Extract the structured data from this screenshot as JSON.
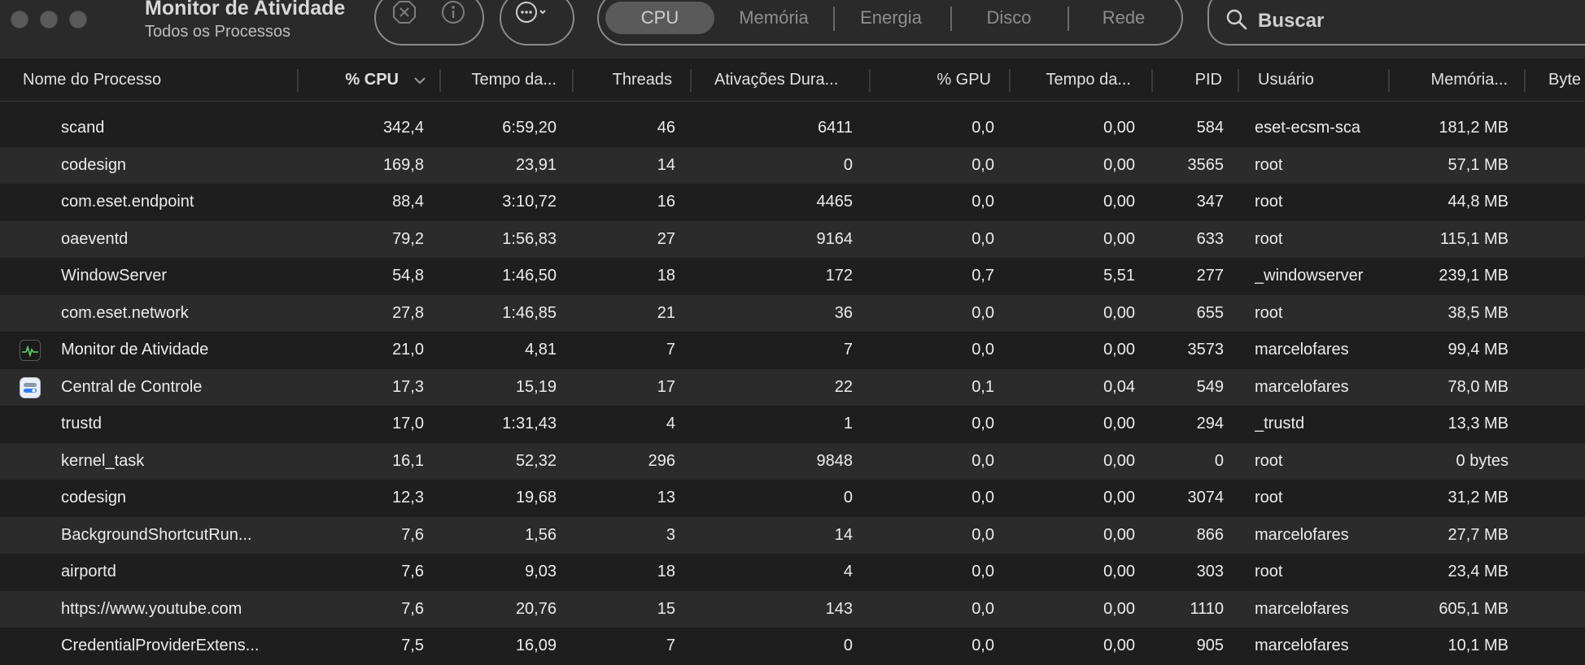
{
  "window": {
    "title": "Monitor de Atividade",
    "subtitle": "Todos os Processos"
  },
  "toolbar": {
    "stop_icon": "stop-process-icon",
    "info_icon": "info-icon",
    "more_icon": "more-options-icon",
    "tabs": [
      {
        "label": "CPU",
        "active": true
      },
      {
        "label": "Memória",
        "active": false
      },
      {
        "label": "Energia",
        "active": false
      },
      {
        "label": "Disco",
        "active": false
      },
      {
        "label": "Rede",
        "active": false
      }
    ],
    "search_label": "Buscar"
  },
  "columns": [
    "Nome do Processo",
    "% CPU",
    "Tempo da...",
    "Threads",
    "Ativações Dura...",
    "% GPU",
    "Tempo da...",
    "PID",
    "Usuário",
    "Memória...",
    "Byte"
  ],
  "sort": {
    "column": "% CPU",
    "direction": "descending"
  },
  "processes": [
    {
      "name": "scand",
      "cpu": "342,4",
      "cpu_time": "6:59,20",
      "threads": "46",
      "wakeups": "6411",
      "gpu": "0,0",
      "gpu_time": "0,00",
      "pid": "584",
      "user": "eset-ecsm-sca",
      "memory": "181,2 MB",
      "icon": ""
    },
    {
      "name": "codesign",
      "cpu": "169,8",
      "cpu_time": "23,91",
      "threads": "14",
      "wakeups": "0",
      "gpu": "0,0",
      "gpu_time": "0,00",
      "pid": "3565",
      "user": "root",
      "memory": "57,1 MB",
      "icon": ""
    },
    {
      "name": "com.eset.endpoint",
      "cpu": "88,4",
      "cpu_time": "3:10,72",
      "threads": "16",
      "wakeups": "4465",
      "gpu": "0,0",
      "gpu_time": "0,00",
      "pid": "347",
      "user": "root",
      "memory": "44,8 MB",
      "icon": ""
    },
    {
      "name": "oaeventd",
      "cpu": "79,2",
      "cpu_time": "1:56,83",
      "threads": "27",
      "wakeups": "9164",
      "gpu": "0,0",
      "gpu_time": "0,00",
      "pid": "633",
      "user": "root",
      "memory": "115,1 MB",
      "icon": ""
    },
    {
      "name": "WindowServer",
      "cpu": "54,8",
      "cpu_time": "1:46,50",
      "threads": "18",
      "wakeups": "172",
      "gpu": "0,7",
      "gpu_time": "5,51",
      "pid": "277",
      "user": "_windowserver",
      "memory": "239,1 MB",
      "icon": ""
    },
    {
      "name": "com.eset.network",
      "cpu": "27,8",
      "cpu_time": "1:46,85",
      "threads": "21",
      "wakeups": "36",
      "gpu": "0,0",
      "gpu_time": "0,00",
      "pid": "655",
      "user": "root",
      "memory": "38,5 MB",
      "icon": ""
    },
    {
      "name": "Monitor de Atividade",
      "cpu": "21,0",
      "cpu_time": "4,81",
      "threads": "7",
      "wakeups": "7",
      "gpu": "0,0",
      "gpu_time": "0,00",
      "pid": "3573",
      "user": "marcelofares",
      "memory": "99,4 MB",
      "icon": "activity-monitor-icon"
    },
    {
      "name": "Central de Controle",
      "cpu": "17,3",
      "cpu_time": "15,19",
      "threads": "17",
      "wakeups": "22",
      "gpu": "0,1",
      "gpu_time": "0,04",
      "pid": "549",
      "user": "marcelofares",
      "memory": "78,0 MB",
      "icon": "control-center-icon"
    },
    {
      "name": "trustd",
      "cpu": "17,0",
      "cpu_time": "1:31,43",
      "threads": "4",
      "wakeups": "1",
      "gpu": "0,0",
      "gpu_time": "0,00",
      "pid": "294",
      "user": "_trustd",
      "memory": "13,3 MB",
      "icon": ""
    },
    {
      "name": "kernel_task",
      "cpu": "16,1",
      "cpu_time": "52,32",
      "threads": "296",
      "wakeups": "9848",
      "gpu": "0,0",
      "gpu_time": "0,00",
      "pid": "0",
      "user": "root",
      "memory": "0 bytes",
      "icon": ""
    },
    {
      "name": "codesign",
      "cpu": "12,3",
      "cpu_time": "19,68",
      "threads": "13",
      "wakeups": "0",
      "gpu": "0,0",
      "gpu_time": "0,00",
      "pid": "3074",
      "user": "root",
      "memory": "31,2 MB",
      "icon": ""
    },
    {
      "name": "BackgroundShortcutRun...",
      "cpu": "7,6",
      "cpu_time": "1,56",
      "threads": "3",
      "wakeups": "14",
      "gpu": "0,0",
      "gpu_time": "0,00",
      "pid": "866",
      "user": "marcelofares",
      "memory": "27,7 MB",
      "icon": ""
    },
    {
      "name": "airportd",
      "cpu": "7,6",
      "cpu_time": "9,03",
      "threads": "18",
      "wakeups": "4",
      "gpu": "0,0",
      "gpu_time": "0,00",
      "pid": "303",
      "user": "root",
      "memory": "23,4 MB",
      "icon": ""
    },
    {
      "name": "https://www.youtube.com",
      "cpu": "7,6",
      "cpu_time": "20,76",
      "threads": "15",
      "wakeups": "143",
      "gpu": "0,0",
      "gpu_time": "0,00",
      "pid": "1110",
      "user": "marcelofares",
      "memory": "605,1 MB",
      "icon": ""
    },
    {
      "name": "CredentialProviderExtens...",
      "cpu": "7,5",
      "cpu_time": "16,09",
      "threads": "7",
      "wakeups": "0",
      "gpu": "0,0",
      "gpu_time": "0,00",
      "pid": "905",
      "user": "marcelofares",
      "memory": "10,1 MB",
      "icon": ""
    }
  ]
}
